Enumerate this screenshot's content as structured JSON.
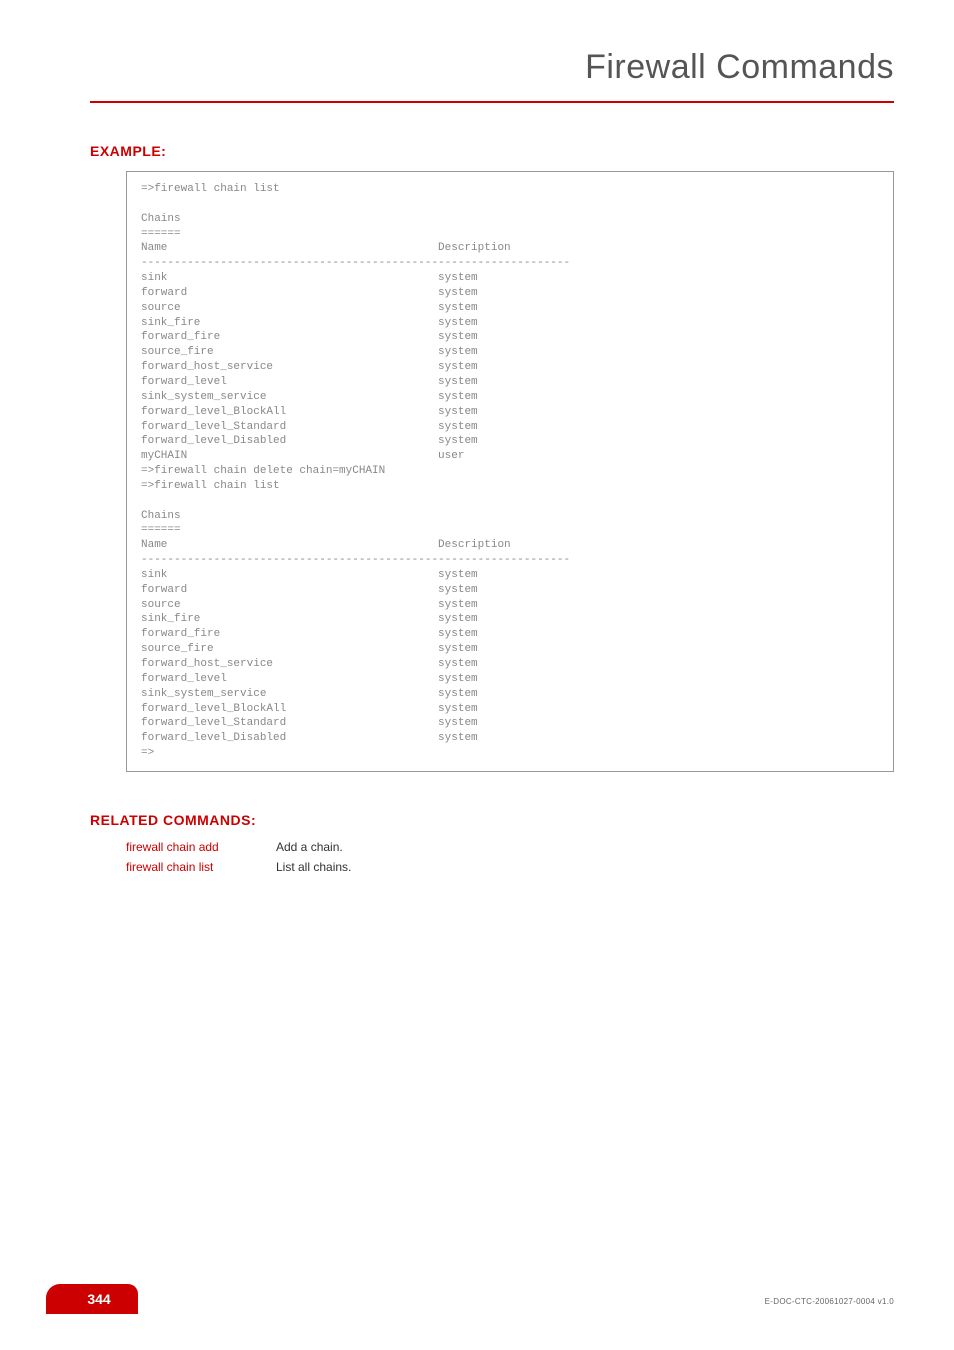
{
  "header": {
    "title": "Firewall Commands"
  },
  "example": {
    "heading": "EXAMPLE:",
    "terminal": "=>firewall chain list\n\nChains\n======\nName                                         Description\n-----------------------------------------------------------------\nsink                                         system\nforward                                      system\nsource                                       system\nsink_fire                                    system\nforward_fire                                 system\nsource_fire                                  system\nforward_host_service                         system\nforward_level                                system\nsink_system_service                          system\nforward_level_BlockAll                       system\nforward_level_Standard                       system\nforward_level_Disabled                       system\nmyCHAIN                                      user\n=>firewall chain delete chain=myCHAIN\n=>firewall chain list\n\nChains\n======\nName                                         Description\n-----------------------------------------------------------------\nsink                                         system\nforward                                      system\nsource                                       system\nsink_fire                                    system\nforward_fire                                 system\nsource_fire                                  system\nforward_host_service                         system\nforward_level                                system\nsink_system_service                          system\nforward_level_BlockAll                       system\nforward_level_Standard                       system\nforward_level_Disabled                       system\n=>"
  },
  "related": {
    "heading": "RELATED COMMANDS:",
    "rows": [
      {
        "cmd": "firewall chain add",
        "desc": "Add a chain."
      },
      {
        "cmd": "firewall chain list",
        "desc": "List all chains."
      }
    ]
  },
  "footer": {
    "page": "344",
    "docid": "E-DOC-CTC-20061027-0004 v1.0"
  }
}
